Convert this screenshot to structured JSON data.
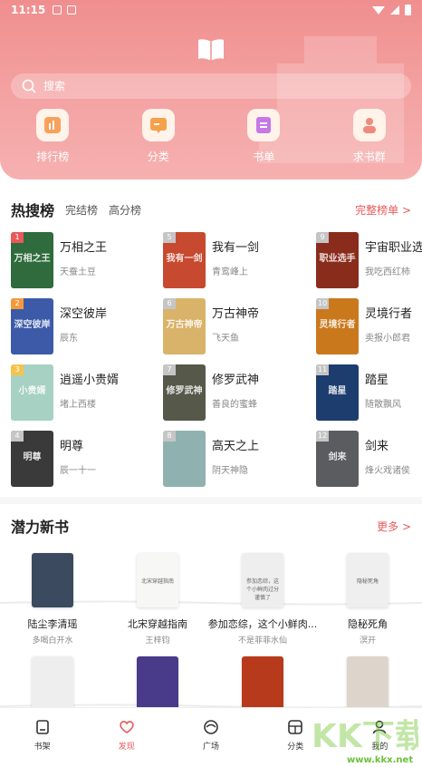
{
  "status_bar": {
    "time": "11:15"
  },
  "search": {
    "placeholder": "搜索"
  },
  "quick_links": [
    {
      "label": "排行榜",
      "icon": "chart-icon",
      "color": "#f7a15c"
    },
    {
      "label": "分类",
      "icon": "category-icon",
      "color": "#f5a04a"
    },
    {
      "label": "书单",
      "icon": "booklist-icon",
      "color": "#c678e6"
    },
    {
      "label": "求书群",
      "icon": "group-icon",
      "color": "#f08a7a"
    }
  ],
  "hot": {
    "title": "热搜榜",
    "tabs": [
      "完结榜",
      "高分榜"
    ],
    "more": "完整榜单 >",
    "books": [
      {
        "rank": "1",
        "name": "万相之王",
        "author": "天蚕土豆",
        "cover": "万相之王",
        "bg": "#2f6b3c"
      },
      {
        "rank": "5",
        "name": "我有一剑",
        "author": "青鸾峰上",
        "cover": "我有一剑",
        "bg": "#c7492f"
      },
      {
        "rank": "9",
        "name": "宇宙职业选手",
        "author": "我吃西红柿",
        "cover": "职业选手",
        "bg": "#8a2c1c"
      },
      {
        "rank": "2",
        "name": "深空彼岸",
        "author": "辰东",
        "cover": "深空彼岸",
        "bg": "#3c5aa8"
      },
      {
        "rank": "6",
        "name": "万古神帝",
        "author": "飞天鱼",
        "cover": "万古神帝",
        "bg": "#d9b36a"
      },
      {
        "rank": "10",
        "name": "灵境行者",
        "author": "卖报小郎君",
        "cover": "灵境行者",
        "bg": "#c9781c"
      },
      {
        "rank": "3",
        "name": "逍遥小贵婿",
        "author": "堵上西楼",
        "cover": "小贵婿",
        "bg": "#a7d1c3"
      },
      {
        "rank": "7",
        "name": "修罗武神",
        "author": "善良的蜜蜂",
        "cover": "修罗武神",
        "bg": "#56584a"
      },
      {
        "rank": "11",
        "name": "踏星",
        "author": "随散飘风",
        "cover": "踏星",
        "bg": "#1d3d6e"
      },
      {
        "rank": "4",
        "name": "明尊",
        "author": "辰一十一",
        "cover": "明尊",
        "bg": "#3a3a3a"
      },
      {
        "rank": "8",
        "name": "高天之上",
        "author": "阴天神隐",
        "cover": "",
        "bg": "#8fb2b0"
      },
      {
        "rank": "12",
        "name": "剑来",
        "author": "烽火戏诸侯",
        "cover": "剑来",
        "bg": "#5a5c60"
      }
    ]
  },
  "potential": {
    "title": "潜力新书",
    "more": "更多 >",
    "books": [
      {
        "name": "陆尘李清瑶",
        "author": "多喝白开水",
        "cover": "",
        "bg": "#3b4a5f"
      },
      {
        "name": "北宋穿越指南",
        "author": "王梓钧",
        "cover": "北宋穿越指南",
        "bg": "#f7f7f5"
      },
      {
        "name": "参加恋综，这个小鲜肉...",
        "author": "不是菲菲水仙",
        "cover": "参加恋综，这个小鲜肉过分谨慎了",
        "bg": "#eeeeee"
      },
      {
        "name": "隐秘死角",
        "author": "溟开",
        "cover": "隐秘死角",
        "bg": "#efefef"
      },
      {
        "name": "",
        "author": "",
        "cover": "",
        "bg": "#eeeeee"
      },
      {
        "name": "",
        "author": "",
        "cover": "",
        "bg": "#4a3a8a"
      },
      {
        "name": "",
        "author": "",
        "cover": "",
        "bg": "#b83a1c"
      },
      {
        "name": "",
        "author": "",
        "cover": "",
        "bg": "#ddd5cc"
      }
    ]
  },
  "nav": {
    "items": [
      {
        "label": "书架",
        "icon": "bookshelf-icon"
      },
      {
        "label": "发现",
        "icon": "discover-icon"
      },
      {
        "label": "广场",
        "icon": "square-icon"
      },
      {
        "label": "分类",
        "icon": "category-icon"
      },
      {
        "label": "我的",
        "icon": "profile-icon"
      }
    ]
  },
  "watermark": {
    "brand": "KK下载",
    "url": "www.kkx.net"
  },
  "colors": {
    "accent": "#e85a5a",
    "header": "#f08e8e"
  }
}
